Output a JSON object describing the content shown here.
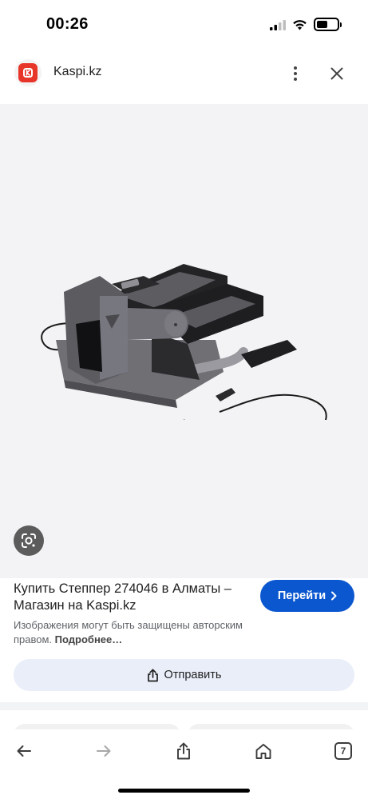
{
  "status_bar": {
    "time": "00:26",
    "icons": [
      "cellular-signal-icon",
      "wifi-icon",
      "battery-icon"
    ],
    "battery_level": 0.55
  },
  "header": {
    "site_name": "Kaspi.kz",
    "logo_icon": "kaspi-logo-icon",
    "more_icon": "more-vertical-icon",
    "close_icon": "close-icon"
  },
  "image": {
    "lens_icon": "google-lens-icon"
  },
  "result": {
    "title": "Купить Степпер 274046 в Алматы – Магазин на Kaspi.kz",
    "visit_label": "Перейти",
    "notice_text": "Изображения могут быть защищены авторским правом.",
    "notice_link": "Подробнее…",
    "share_label": "Отправить"
  },
  "toolbar": {
    "back_icon": "arrow-left-icon",
    "forward_icon": "arrow-right-icon",
    "share_icon": "share-icon",
    "home_icon": "home-icon",
    "tabs_count": "7"
  },
  "colors": {
    "accent": "#0b57d0",
    "share_bg": "#e9eef9",
    "logo_red": "#e8352a"
  }
}
